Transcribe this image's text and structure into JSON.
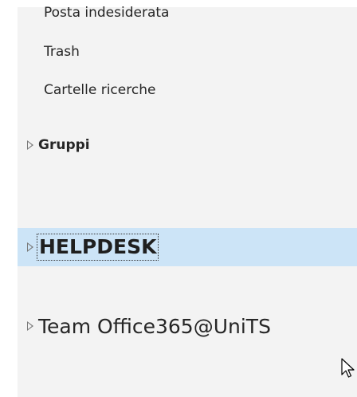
{
  "folders": [
    {
      "label": "Posta indesiderata"
    },
    {
      "label": "Trash"
    },
    {
      "label": "Cartelle ricerche"
    }
  ],
  "groups": {
    "gruppi": "Gruppi",
    "helpdesk": "HELPDESK",
    "team": "Team Office365@UniTS"
  },
  "colors": {
    "pane_background": "#f3f3f3",
    "selected_background": "#cce4f7"
  },
  "icons": {
    "expand": "triangle-right-icon",
    "cursor": "mouse-pointer-icon"
  }
}
